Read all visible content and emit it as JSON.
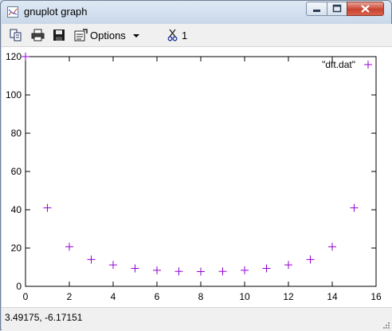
{
  "window": {
    "title": "gnuplot graph",
    "titlebar_buttons": [
      "minimize",
      "maximize",
      "close"
    ]
  },
  "toolbar": {
    "items": [
      {
        "icon": "copy-icon"
      },
      {
        "icon": "print-icon"
      },
      {
        "icon": "save-icon"
      },
      {
        "icon": "options-icon",
        "label": "Options"
      },
      {
        "icon": "scissors-icon",
        "label": "1"
      }
    ]
  },
  "status": {
    "coordinates": "3.49175, -6.17151"
  },
  "colors": {
    "series": "#9400d3",
    "axis": "#000000"
  },
  "chart_data": {
    "type": "scatter",
    "legend": "top-right",
    "grid": false,
    "xlim": [
      0,
      16
    ],
    "ylim": [
      0,
      120
    ],
    "xticks": [
      "0",
      "2",
      "4",
      "6",
      "8",
      "10",
      "12",
      "14",
      "16"
    ],
    "yticks": [
      "0",
      "20",
      "40",
      "60",
      "80",
      "100",
      "120"
    ],
    "series": [
      {
        "name": "\"dft.dat\"",
        "marker": "plus",
        "x": [
          0,
          1,
          2,
          3,
          4,
          5,
          6,
          7,
          8,
          9,
          10,
          11,
          12,
          13,
          14,
          15
        ],
        "y": [
          120,
          41,
          20.7,
          14,
          11.2,
          9.4,
          8.4,
          7.8,
          7.7,
          7.8,
          8.4,
          9.4,
          11.2,
          14,
          20.7,
          41
        ]
      }
    ]
  }
}
